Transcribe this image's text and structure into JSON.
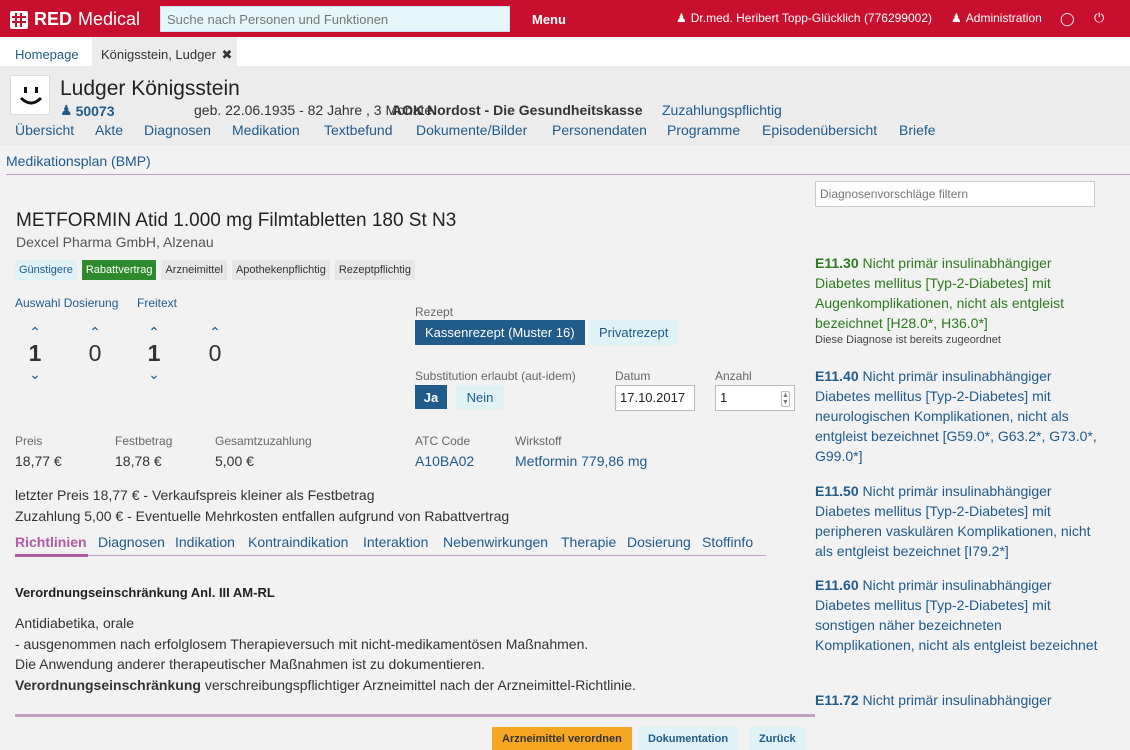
{
  "topbar": {
    "logo_red": "RED",
    "logo_text": "Medical",
    "search_placeholder": "Suche nach Personen und Funktionen",
    "menu": "Menu",
    "user": "Dr.med. Heribert Topp-Glücklich (776299002)",
    "admin": "Administration"
  },
  "tabs": {
    "home": "Homepage",
    "active": "Königsstein, Ludger"
  },
  "patient": {
    "name": "Ludger Königsstein",
    "id": "50073",
    "dob": "geb. 22.06.1935 - 82 Jahre , 3 Monate",
    "insurance": "AOK Nordost - Die Gesundheitskasse",
    "copay": "Zuzahlungspflichtig",
    "nav": [
      "Übersicht",
      "Akte",
      "Diagnosen",
      "Medikation",
      "Textbefund",
      "Dokumente/Bilder",
      "Personendaten",
      "Programme",
      "Episodenübersicht",
      "Briefe"
    ]
  },
  "section": {
    "title": "Medikationsplan (BMP)"
  },
  "drug": {
    "title": "METFORMIN Atid 1.000 mg Filmtabletten 180 St N3",
    "maker": "Dexcel Pharma GmbH, Alzenau",
    "badges": [
      "Günstigere",
      "Rabattvertrag",
      "Arzneimittel",
      "Apothekenpflichtig",
      "Rezeptpflichtig"
    ]
  },
  "dosage": {
    "auswahl": "Auswahl Dosierung",
    "freitext": "Freitext",
    "values": [
      "1",
      "0",
      "1",
      "0"
    ]
  },
  "prescription": {
    "label": "Rezept",
    "kassen": "Kassenrezept (Muster 16)",
    "privat": "Privatrezept",
    "subst_label": "Substitution erlaubt (aut-idem)",
    "ja": "Ja",
    "nein": "Nein",
    "datum_label": "Datum",
    "datum": "17.10.2017",
    "anzahl_label": "Anzahl",
    "anzahl": "1"
  },
  "prices": {
    "preis_label": "Preis",
    "preis": "18,77 €",
    "fest_label": "Festbetrag",
    "fest": "18,78 €",
    "gesamt_label": "Gesamtzuzahlung",
    "gesamt": "5,00 €",
    "atc_label": "ATC Code",
    "atc": "A10BA02",
    "wirk_label": "Wirkstoff",
    "wirk": "Metformin 779,86 mg"
  },
  "notes": {
    "line1": "letzter Preis 18,77 € - Verkaufspreis kleiner als Festbetrag",
    "line2": "Zuzahlung 5,00 € - Eventuelle Mehrkosten entfallen aufgrund von Rabattvertrag"
  },
  "info_tabs": [
    "Richtlinien",
    "Diagnosen",
    "Indikation",
    "Kontraindikation",
    "Interaktion",
    "Nebenwirkungen",
    "Therapie",
    "Dosierung",
    "Stoffinfo"
  ],
  "guideline": {
    "title": "Verordnungseinschränkung Anl. III AM-RL",
    "l1": "Antidiabetika, orale",
    "l2": "- ausgenommen nach erfolglosem Therapieversuch mit nicht-medikamentösen Maßnahmen.",
    "l3": "Die Anwendung anderer therapeutischer Maßnahmen ist zu dokumentieren.",
    "l4_bold": "Verordnungseinschränkung",
    "l4_rest": " verschreibungspflichtiger Arzneimittel nach der Arzneimittel-Richtlinie."
  },
  "buttons": {
    "prescribe": "Arzneimittel verordnen",
    "doc": "Dokumentation",
    "back": "Zurück"
  },
  "diagnoses": {
    "filter_placeholder": "Diagnosenvorschläge filtern",
    "assigned_note": "Diese Diagnose ist bereits zugeordnet",
    "items": [
      {
        "code": "E11.30",
        "text": " Nicht primär insulinabhängiger Diabetes mellitus [Typ-2-Diabetes] mit Augenkomplikationen, nicht als entgleist bezeichnet [H28.0*, H36.0*]"
      },
      {
        "code": "E11.40",
        "text": " Nicht primär insulinabhängiger Diabetes mellitus [Typ-2-Diabetes] mit neurologischen Komplikationen, nicht als entgleist bezeichnet [G59.0*, G63.2*, G73.0*, G99.0*]"
      },
      {
        "code": "E11.50",
        "text": " Nicht primär insulinabhängiger Diabetes mellitus [Typ-2-Diabetes] mit peripheren vaskulären Komplikationen, nicht als entgleist bezeichnet [I79.2*]"
      },
      {
        "code": "E11.60",
        "text": " Nicht primär insulinabhängiger Diabetes mellitus [Typ-2-Diabetes] mit sonstigen näher bezeichneten Komplikationen, nicht als entgleist bezeichnet"
      },
      {
        "code": "E11.72",
        "text": " Nicht primär insulinabhängiger"
      }
    ]
  }
}
